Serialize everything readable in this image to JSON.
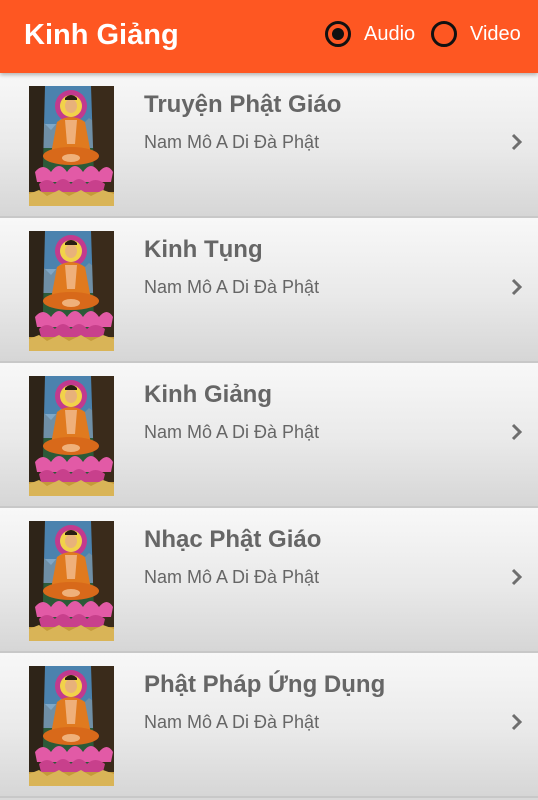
{
  "appbar": {
    "title": "Kinh Giảng",
    "background": "#fe5722",
    "options": [
      {
        "label": "Audio",
        "selected": true
      },
      {
        "label": "Video",
        "selected": false
      }
    ]
  },
  "list": {
    "items": [
      {
        "title": "Truyện Phật Giáo",
        "subtitle": "Nam Mô A Di Đà Phật",
        "image": "buddha-image",
        "icon": "chevron-right-icon"
      },
      {
        "title": "Kinh Tụng",
        "subtitle": "Nam Mô A Di Đà Phật",
        "image": "buddha-image",
        "icon": "chevron-right-icon"
      },
      {
        "title": "Kinh Giảng",
        "subtitle": "Nam Mô A Di Đà Phật",
        "image": "buddha-image",
        "icon": "chevron-right-icon"
      },
      {
        "title": "Nhạc Phật Giáo",
        "subtitle": "Nam Mô A Di Đà Phật",
        "image": "buddha-image",
        "icon": "chevron-right-icon"
      },
      {
        "title": "Phật Pháp Ứng Dụng",
        "subtitle": "Nam Mô A Di Đà Phật",
        "image": "buddha-image",
        "icon": "chevron-right-icon"
      }
    ]
  }
}
